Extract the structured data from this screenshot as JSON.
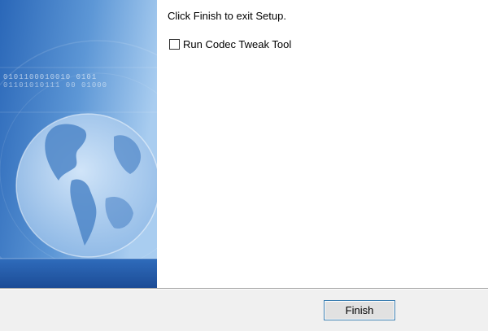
{
  "content": {
    "message": "Click Finish to exit Setup.",
    "checkbox": {
      "label": "Run Codec Tweak Tool",
      "checked": false
    }
  },
  "footer": {
    "finish_label": "Finish"
  },
  "side_panel": {
    "binary_text_1": "0101100010010 0101",
    "binary_text_2": "01101010111 00 01000"
  },
  "colors": {
    "panel_dark": "#1e4f9c",
    "panel_light": "#9cc4ec",
    "button_border": "#3c7fb1"
  }
}
